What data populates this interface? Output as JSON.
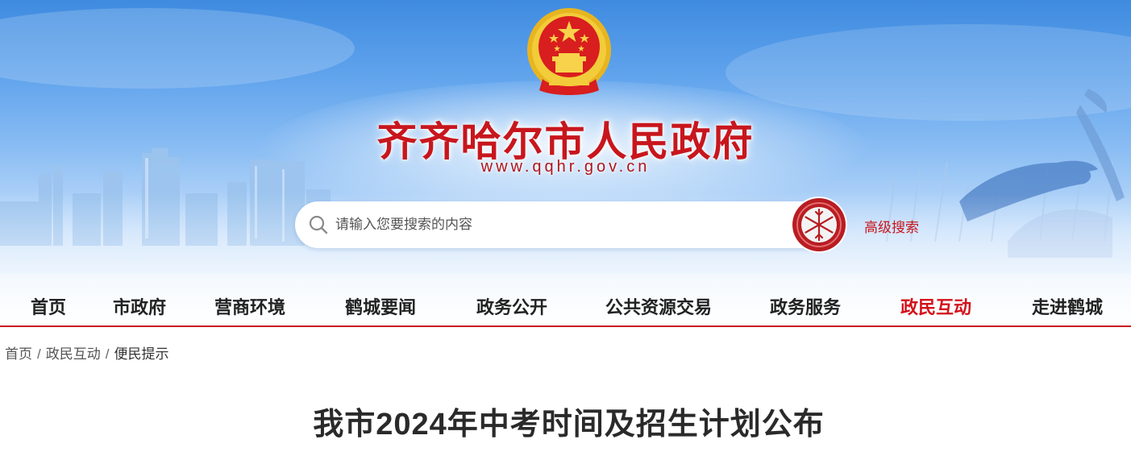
{
  "header": {
    "site_title": "齐齐哈尔市人民政府",
    "site_url": "www.qqhr.gov.cn"
  },
  "search": {
    "placeholder": "请输入您要搜索的内容",
    "value": "",
    "advanced_label": "高级搜索"
  },
  "nav": {
    "items": [
      {
        "label": "首页"
      },
      {
        "label": "市政府"
      },
      {
        "label": "营商环境"
      },
      {
        "label": "鹤城要闻"
      },
      {
        "label": "政务公开"
      },
      {
        "label": "公共资源交易"
      },
      {
        "label": "政务服务"
      },
      {
        "label": "政民互动"
      },
      {
        "label": "走进鹤城"
      }
    ],
    "active_index": 7
  },
  "breadcrumb": {
    "items": [
      "首页",
      "政民互动",
      "便民提示"
    ],
    "separator": "/"
  },
  "article": {
    "title": "我市2024年中考时间及招生计划公布"
  },
  "colors": {
    "accent_red": "#c8161d",
    "nav_active": "#d4121b",
    "banner_blue": "#4a92e4"
  },
  "icons": {
    "emblem": "national-emblem-icon",
    "search": "search-icon",
    "search_button": "snowflake-search-icon"
  }
}
